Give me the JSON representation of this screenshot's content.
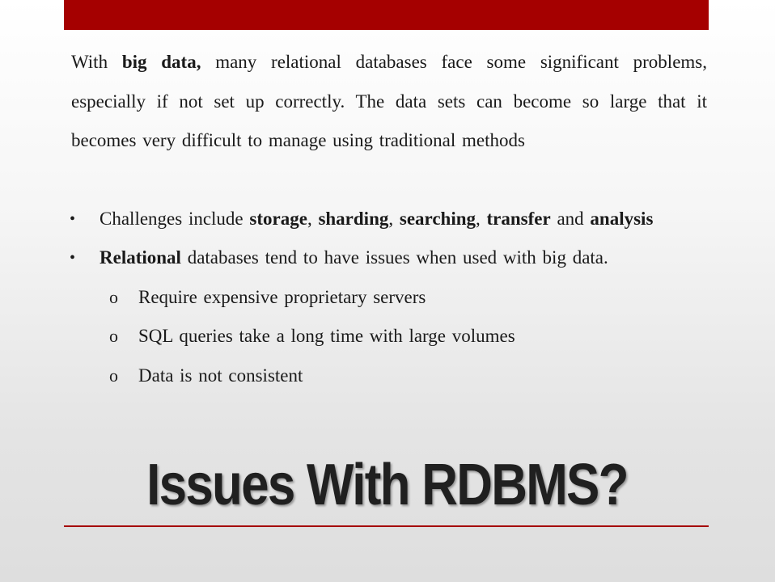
{
  "colors": {
    "accent": "#a50000",
    "text": "#1a1a1a",
    "title": "#202020"
  },
  "intro": {
    "lead": "With ",
    "bold": "big data,",
    "rest": " many relational databases face some significant problems, especially if not set up correctly. The data sets can become so large that it becomes very difficult to manage using traditional methods"
  },
  "bullets": [
    {
      "mark": "•",
      "t0": "Challenges include ",
      "b1": "storage",
      "t1": ", ",
      "b2": "sharding",
      "t2": ", ",
      "b3": "searching",
      "t3": ", ",
      "b4": "transfer",
      "t4": " and ",
      "b5": "analysis"
    },
    {
      "mark": "•",
      "b1": "Relational",
      "t1": " databases tend to have issues when used with big data.",
      "sub_items": [
        {
          "mark": "o",
          "text": "Require expensive proprietary servers"
        },
        {
          "mark": "o",
          "text": "SQL queries take a long time with large volumes"
        },
        {
          "mark": "o",
          "text": "Data is not consistent"
        }
      ]
    }
  ],
  "title": "Issues With RDBMS?"
}
